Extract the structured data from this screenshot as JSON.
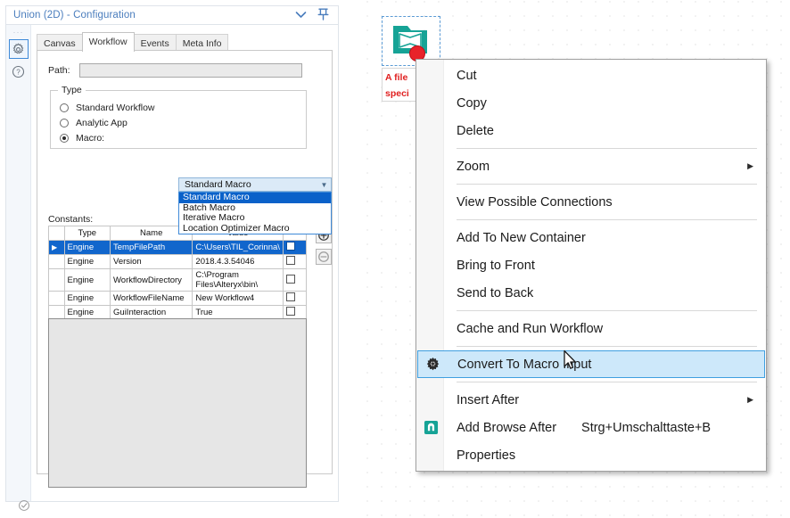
{
  "config_panel": {
    "title": "Union (2D) - Configuration",
    "titlebar_icons": {
      "collapse": "chevron-down-icon",
      "pin": "pin-icon"
    },
    "rail": {
      "grip": "···",
      "gear": "gear-icon",
      "help": "help-icon"
    },
    "tabs": [
      {
        "label": "Canvas",
        "active": false
      },
      {
        "label": "Workflow",
        "active": true
      },
      {
        "label": "Events",
        "active": false
      },
      {
        "label": "Meta Info",
        "active": false
      }
    ],
    "path": {
      "label": "Path:",
      "value": "",
      "placeholder": ""
    },
    "type_group": {
      "legend": "Type",
      "options": [
        {
          "label": "Standard Workflow",
          "selected": false
        },
        {
          "label": "Analytic App",
          "selected": false
        },
        {
          "label": "Macro:",
          "selected": true
        }
      ]
    },
    "macro_combo": {
      "value": "Standard Macro",
      "arrow": "chevron-down-icon",
      "options": [
        "Standard Macro",
        "Batch Macro",
        "Iterative Macro",
        "Location Optimizer Macro"
      ],
      "selected_option": "Standard Macro"
    },
    "constants": {
      "label": "Constants:",
      "columns": [
        "",
        "Type",
        "Name",
        "Value",
        ""
      ],
      "rows": [
        {
          "marker": "▶",
          "type": "Engine",
          "name": "TempFilePath",
          "value": "C:\\Users\\TIL_Corinna\\",
          "checked": false,
          "selected": true
        },
        {
          "marker": "",
          "type": "Engine",
          "name": "Version",
          "value": "2018.4.3.54046",
          "checked": false,
          "selected": false
        },
        {
          "marker": "",
          "type": "Engine",
          "name": "WorkflowDirectory",
          "value": "C:\\Program Files\\Alteryx\\bin\\",
          "checked": false,
          "selected": false
        },
        {
          "marker": "",
          "type": "Engine",
          "name": "WorkflowFileName",
          "value": "New Workflow4",
          "checked": false,
          "selected": false
        },
        {
          "marker": "",
          "type": "Engine",
          "name": "GuiInteraction",
          "value": "True",
          "checked": false,
          "selected": false
        }
      ],
      "add_button": "plus-circle-icon",
      "remove_button": "minus-circle-icon"
    },
    "status_icon": "check-circle-icon"
  },
  "canvas": {
    "tool": {
      "icon": "input-data-tool-icon",
      "error_badge": "error-badge-icon",
      "error_text_line1": "A file",
      "error_text_line2": "speci"
    },
    "context_menu": [
      {
        "label": "Cut",
        "icon": "",
        "accel": "",
        "submenu": false,
        "highlighted": false,
        "separator_after": false
      },
      {
        "label": "Copy",
        "icon": "",
        "accel": "",
        "submenu": false,
        "highlighted": false,
        "separator_after": false
      },
      {
        "label": "Delete",
        "icon": "",
        "accel": "",
        "submenu": false,
        "highlighted": false,
        "separator_after": true
      },
      {
        "label": "Zoom",
        "icon": "",
        "accel": "",
        "submenu": true,
        "highlighted": false,
        "separator_after": true
      },
      {
        "label": "View Possible Connections",
        "icon": "",
        "accel": "",
        "submenu": false,
        "highlighted": false,
        "separator_after": true
      },
      {
        "label": "Add To New Container",
        "icon": "",
        "accel": "",
        "submenu": false,
        "highlighted": false,
        "separator_after": false
      },
      {
        "label": "Bring to Front",
        "icon": "",
        "accel": "",
        "submenu": false,
        "highlighted": false,
        "separator_after": false
      },
      {
        "label": "Send to Back",
        "icon": "",
        "accel": "",
        "submenu": false,
        "highlighted": false,
        "separator_after": true
      },
      {
        "label": "Cache and Run Workflow",
        "icon": "",
        "accel": "",
        "submenu": false,
        "highlighted": false,
        "separator_after": true
      },
      {
        "label": "Convert To Macro Input",
        "icon": "macro-input-gear-icon",
        "accel": "",
        "submenu": false,
        "highlighted": true,
        "separator_after": true
      },
      {
        "label": "Insert After",
        "icon": "",
        "accel": "",
        "submenu": true,
        "highlighted": false,
        "separator_after": false
      },
      {
        "label": "Add Browse After",
        "icon": "browse-tool-icon",
        "accel": "Strg+Umschalttaste+B",
        "submenu": false,
        "highlighted": false,
        "separator_after": false
      },
      {
        "label": "Properties",
        "icon": "",
        "accel": "",
        "submenu": false,
        "highlighted": false,
        "separator_after": false
      }
    ],
    "cursor": "mouse-pointer-icon"
  },
  "colors": {
    "accent_blue": "#4a7dbd",
    "selection_blue": "#1166cc",
    "menu_highlight": "#cde8fa",
    "tool_teal": "#16a396",
    "error_red": "#e8232a",
    "combo_blue": "#dbeaf7"
  }
}
